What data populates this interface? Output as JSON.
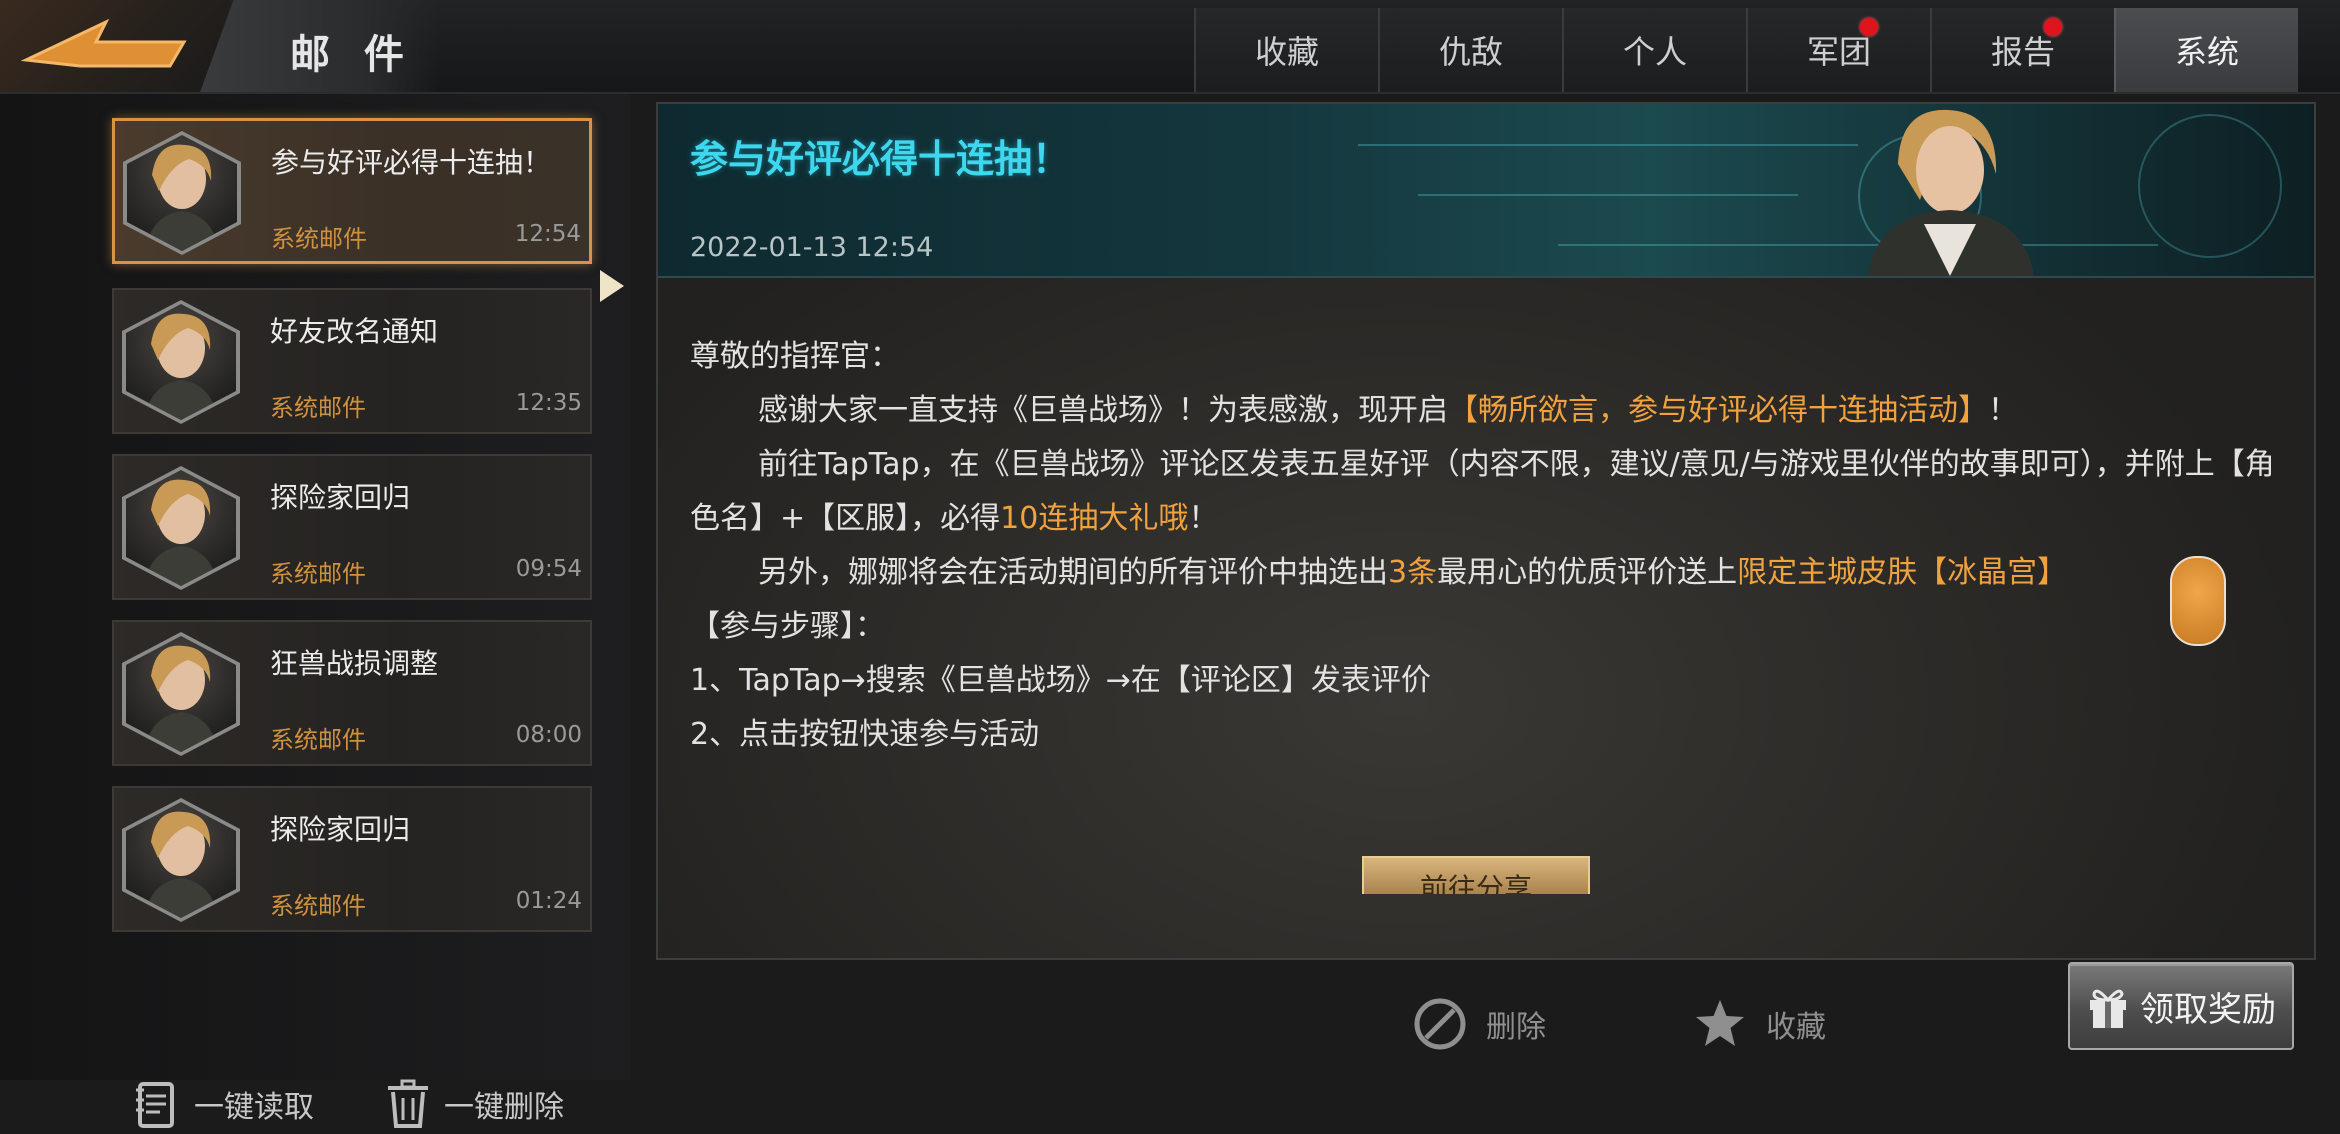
{
  "header": {
    "title": "邮 件",
    "tabs": [
      {
        "label": "收藏",
        "badge": false,
        "active": false
      },
      {
        "label": "仇敌",
        "badge": false,
        "active": false
      },
      {
        "label": "个人",
        "badge": false,
        "active": false
      },
      {
        "label": "军团",
        "badge": true,
        "active": false
      },
      {
        "label": "报告",
        "badge": true,
        "active": false
      },
      {
        "label": "系统",
        "badge": false,
        "active": true
      }
    ]
  },
  "mail_list": [
    {
      "subject": "参与好评必得十连抽！",
      "sender": "系统邮件",
      "time": "12:54",
      "selected": true
    },
    {
      "subject": "好友改名通知",
      "sender": "系统邮件",
      "time": "12:35",
      "selected": false
    },
    {
      "subject": "探险家回归",
      "sender": "系统邮件",
      "time": "09:54",
      "selected": false
    },
    {
      "subject": "狂兽战损调整",
      "sender": "系统邮件",
      "time": "08:00",
      "selected": false
    },
    {
      "subject": "探险家回归",
      "sender": "系统邮件",
      "time": "01:24",
      "selected": false
    }
  ],
  "list_actions": {
    "read_all": "一键读取",
    "delete_all": "一键删除"
  },
  "mail_detail": {
    "title": "参与好评必得十连抽！",
    "date": "2022-01-13  12:54",
    "greeting": "尊敬的指挥官：",
    "p1_a": "感谢大家一直支持《巨兽战场》！为表感激，现开启",
    "p1_hl": "【畅所欲言，参与好评必得十连抽活动】",
    "p1_b": "！",
    "p2_a": "前往TapTap，在《巨兽战场》评论区发表五星好评（内容不限，建议/意见/与游戏里伙伴的故事即可），并附上【角色名】+【区服】，必得",
    "p2_hl": "10连抽大礼哦",
    "p2_b": "！",
    "p3_a": "另外，娜娜将会在活动期间的所有评价中抽选出",
    "p3_hl1": "3条",
    "p3_b": "最用心的优质评价送上",
    "p3_hl2": "限定主城皮肤【冰晶宫】",
    "steps_title": "【参与步骤】：",
    "step1": "1、TapTap→搜索《巨兽战场》→在【评论区】发表评价",
    "step2": "2、点击按钮快速参与活动",
    "go_button": "前往分享"
  },
  "footer": {
    "delete": "删除",
    "favorite": "收藏",
    "claim": "领取奖励"
  },
  "icons": [
    "back-arrow-icon",
    "hero-avatar-icon",
    "notepad-icon",
    "trash-icon",
    "no-entry-icon",
    "star-icon",
    "gift-icon",
    "cat-mascot-icon"
  ],
  "colors": {
    "accent": "#d79347",
    "highlight": "#f0a23e",
    "title_cyan": "#3fd7ee",
    "badge": "#e0141c"
  }
}
